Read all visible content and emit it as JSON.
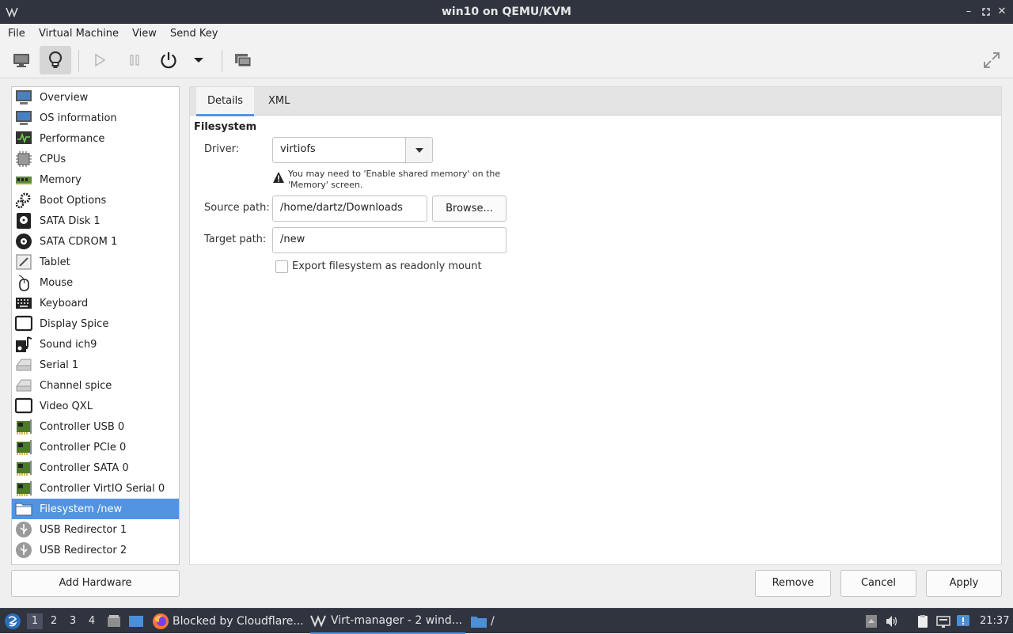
{
  "window": {
    "title": "win10 on QEMU/KVM"
  },
  "menu": {
    "items": [
      "File",
      "Virtual Machine",
      "View",
      "Send Key"
    ]
  },
  "sidebar": {
    "items": [
      {
        "label": "Overview",
        "icon": "monitor-icon"
      },
      {
        "label": "OS information",
        "icon": "monitor-icon"
      },
      {
        "label": "Performance",
        "icon": "performance-icon"
      },
      {
        "label": "CPUs",
        "icon": "cpu-icon"
      },
      {
        "label": "Memory",
        "icon": "memory-icon"
      },
      {
        "label": "Boot Options",
        "icon": "gears-icon"
      },
      {
        "label": "SATA Disk 1",
        "icon": "disk-icon"
      },
      {
        "label": "SATA CDROM 1",
        "icon": "cdrom-icon"
      },
      {
        "label": "Tablet",
        "icon": "tablet-icon"
      },
      {
        "label": "Mouse",
        "icon": "mouse-icon"
      },
      {
        "label": "Keyboard",
        "icon": "keyboard-icon"
      },
      {
        "label": "Display Spice",
        "icon": "display-icon"
      },
      {
        "label": "Sound ich9",
        "icon": "sound-icon"
      },
      {
        "label": "Serial 1",
        "icon": "serial-icon"
      },
      {
        "label": "Channel spice",
        "icon": "serial-icon"
      },
      {
        "label": "Video QXL",
        "icon": "display-icon"
      },
      {
        "label": "Controller USB 0",
        "icon": "pci-card-icon"
      },
      {
        "label": "Controller PCIe 0",
        "icon": "pci-card-icon"
      },
      {
        "label": "Controller SATA 0",
        "icon": "pci-card-icon"
      },
      {
        "label": "Controller VirtIO Serial 0",
        "icon": "pci-card-icon"
      },
      {
        "label": "Filesystem /new",
        "icon": "folder-icon",
        "selected": true
      },
      {
        "label": "USB Redirector 1",
        "icon": "usb-icon"
      },
      {
        "label": "USB Redirector 2",
        "icon": "usb-icon"
      }
    ],
    "add_hardware": "Add Hardware"
  },
  "tabs": [
    "Details",
    "XML"
  ],
  "filesystem": {
    "section_title": "Filesystem",
    "driver_label": "Driver:",
    "driver_value": "virtiofs",
    "warning": "You may need to 'Enable shared memory' on the 'Memory' screen.",
    "source_label": "Source path:",
    "source_value": "/home/dartz/Downloads",
    "browse": "Browse...",
    "target_label": "Target path:",
    "target_value": "/new",
    "readonly_label": "Export filesystem as readonly mount",
    "readonly_checked": false
  },
  "buttons": {
    "remove": "Remove",
    "cancel": "Cancel",
    "apply": "Apply"
  },
  "taskbar": {
    "workspaces": [
      "1",
      "2",
      "3",
      "4"
    ],
    "tasks": [
      "Blocked by Cloudflare...",
      "Virt-manager - 2 wind...",
      "/"
    ],
    "clock": "21:37"
  },
  "colors": {
    "accent": "#5294e2",
    "titlebar": "#2f343f"
  }
}
